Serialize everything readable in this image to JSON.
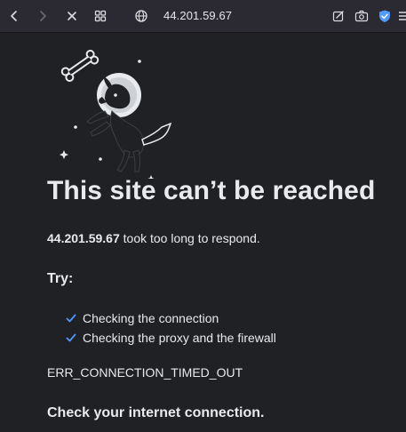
{
  "toolbar": {
    "url": "44.201.59.67",
    "icons": [
      "back-icon",
      "forward-icon",
      "stop-icon",
      "grid-icon",
      "globe-icon",
      "edit-icon",
      "camera-icon",
      "shield-icon",
      "menu-icon"
    ]
  },
  "page": {
    "illustration": "dog-in-space-icon",
    "title": "This site can’t be reached",
    "host": "44.201.59.67",
    "description_rest": " took too long to respond.",
    "try_label": "Try:",
    "suggestions": [
      "Checking the connection",
      "Checking the proxy and the firewall"
    ],
    "error_code": "ERR_CONNECTION_TIMED_OUT",
    "check_connection": "Check your internet connection."
  },
  "colors": {
    "background": "#202124",
    "toolbar": "#2b2a33",
    "text": "#e8eaed",
    "accent": "#4e9bfd"
  }
}
